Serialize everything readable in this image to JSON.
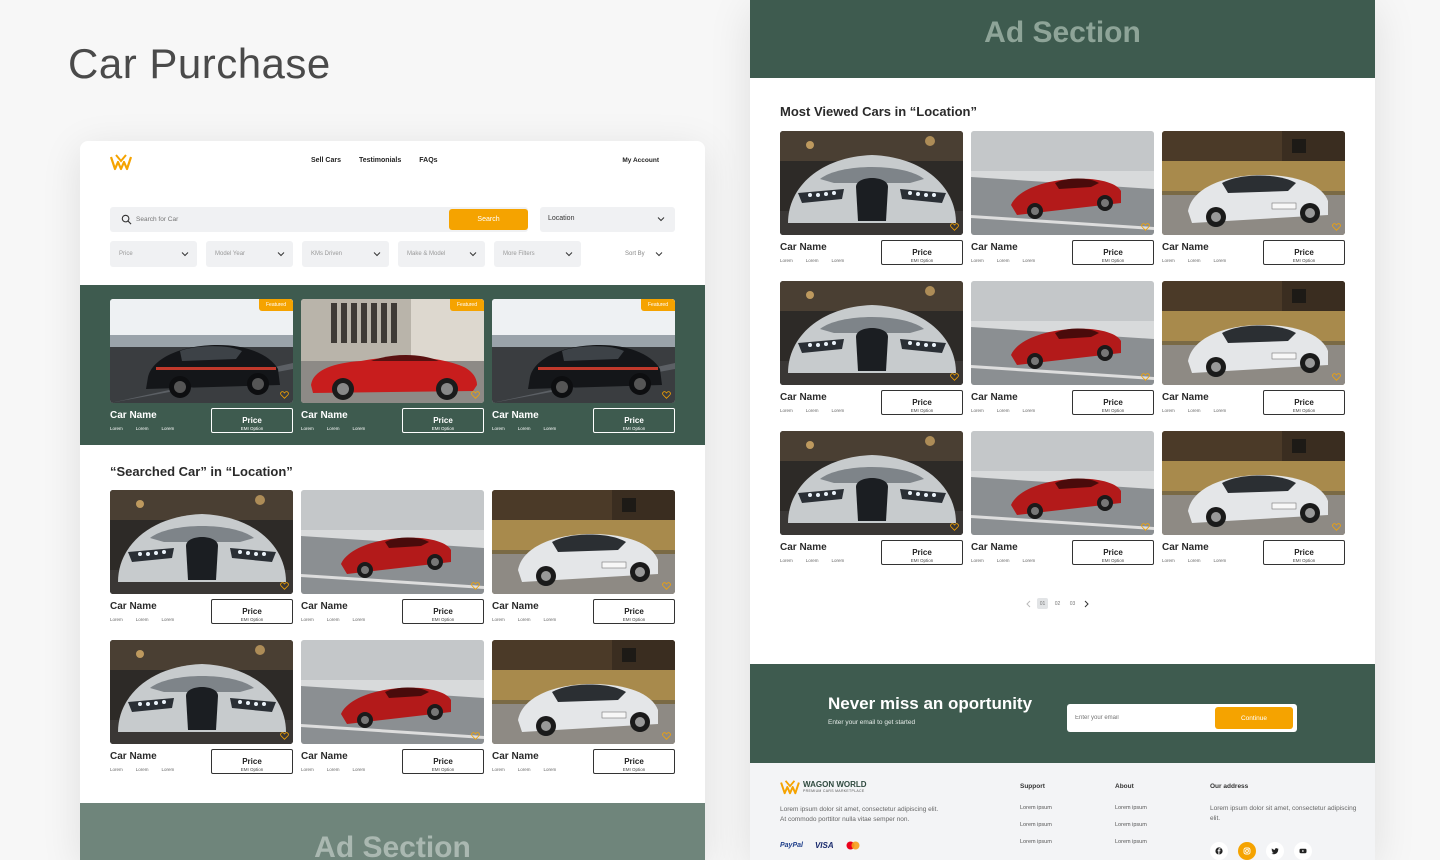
{
  "page_title": "Car Purchase",
  "nav": {
    "links": [
      "Sell Cars",
      "Testimonials",
      "FAQs"
    ],
    "account": "My Account"
  },
  "search": {
    "placeholder": "Search for Car",
    "button": "Search",
    "location": "Location"
  },
  "filters": [
    "Price",
    "Model Year",
    "KMs Driven",
    "Make & Model",
    "More Filters"
  ],
  "sort_label": "Sort By",
  "card": {
    "name": "Car Name",
    "price": "Price",
    "emi": "EMI Option",
    "meta": [
      "Lorem",
      "Lorem",
      "Lorem"
    ],
    "featured_badge": "Featured"
  },
  "searched_heading": "“Searched Car”  in “Location”",
  "ad_section": "Ad Section",
  "most_viewed_heading": "Most Viewed Cars in “Location”",
  "pagination": [
    "01",
    "02",
    "03"
  ],
  "newsletter": {
    "title": "Never miss an oportunity",
    "subtitle": "Enter your email to get started",
    "placeholder": "Enter your email",
    "button": "Continue"
  },
  "footer": {
    "brand": "WAGON WORLD",
    "tagline": "PREMIUM CARS MARKETPLACE",
    "description": "Lorem ipsum dolor sit amet, consectetur adipiscing elit. At commodo porttitor nulla vitae semper non.",
    "payments": [
      "PayPal",
      "VISA"
    ],
    "support": {
      "heading": "Support",
      "items": [
        "Lorem ipsum",
        "Lorem ipsum",
        "Lorem ipsum"
      ]
    },
    "about": {
      "heading": "About",
      "items": [
        "Lorem ipsum",
        "Lorem ipsum",
        "Lorem ipsum"
      ]
    },
    "address": {
      "heading": "Our address",
      "text": "Lorem ipsum dolor sit amet, consectetur adipiscing elit."
    }
  },
  "colors": {
    "accent": "#f5a300",
    "primary_green": "#3e5b4f",
    "ad_green": "#6f857b"
  }
}
